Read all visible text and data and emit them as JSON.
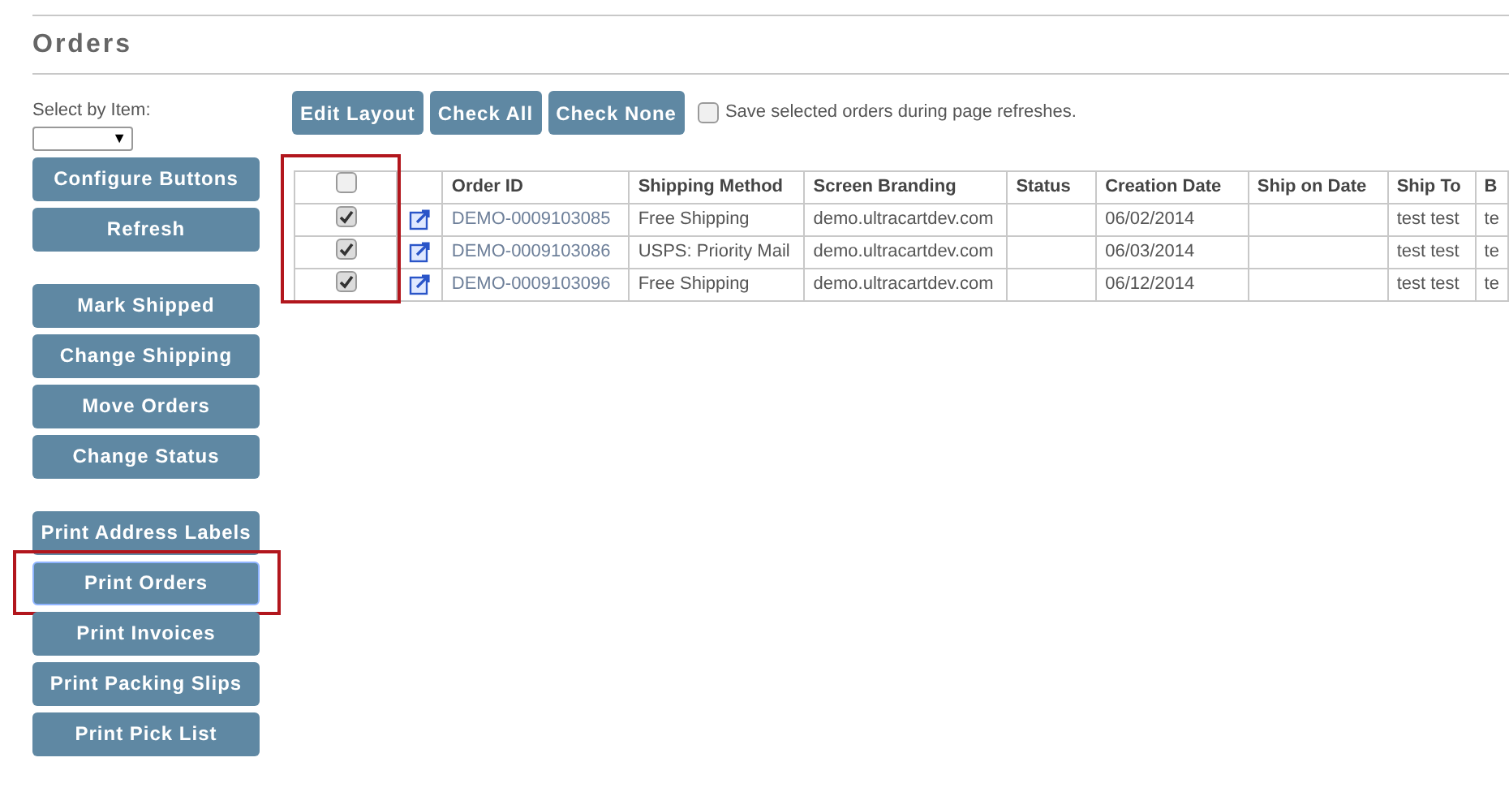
{
  "page": {
    "title": "Orders"
  },
  "select_by_item": {
    "label": "Select by Item:",
    "caret": "▼"
  },
  "sidebar_groups": [
    {
      "buttons": [
        {
          "label": "Configure Buttons",
          "highlighted": false
        },
        {
          "label": "Refresh",
          "highlighted": false
        }
      ]
    },
    {
      "buttons": [
        {
          "label": "Mark Shipped",
          "highlighted": false
        },
        {
          "label": "Change Shipping",
          "highlighted": false
        },
        {
          "label": "Move Orders",
          "highlighted": false
        },
        {
          "label": "Change Status",
          "highlighted": false
        }
      ]
    },
    {
      "buttons": [
        {
          "label": "Print Address Labels",
          "highlighted": false
        },
        {
          "label": "Print Orders",
          "highlighted": true
        },
        {
          "label": "Print Invoices",
          "highlighted": false
        },
        {
          "label": "Print Packing Slips",
          "highlighted": false
        },
        {
          "label": "Print Pick List",
          "highlighted": false
        }
      ]
    }
  ],
  "toolbar": {
    "buttons": [
      "Edit Layout",
      "Check All",
      "Check None"
    ],
    "save_selection": {
      "label": "Save selected orders during page refreshes.",
      "checked": false
    }
  },
  "table": {
    "select_column_highlighted": true,
    "header_checked": false,
    "columns": [
      "Order ID",
      "Shipping Method",
      "Screen Branding",
      "Status",
      "Creation Date",
      "Ship on Date",
      "Ship To",
      "B"
    ],
    "rows": [
      {
        "checked": true,
        "cells": [
          "DEMO-0009103085",
          "Free Shipping",
          "demo.ultracartdev.com",
          "",
          "06/02/2014",
          "",
          "test test",
          "te"
        ]
      },
      {
        "checked": true,
        "cells": [
          "DEMO-0009103086",
          "USPS: Priority Mail",
          "demo.ultracartdev.com",
          "",
          "06/03/2014",
          "",
          "test test",
          "te"
        ]
      },
      {
        "checked": true,
        "cells": [
          "DEMO-0009103096",
          "Free Shipping",
          "demo.ultracartdev.com",
          "",
          "06/12/2014",
          "",
          "test test",
          "te"
        ]
      }
    ]
  }
}
